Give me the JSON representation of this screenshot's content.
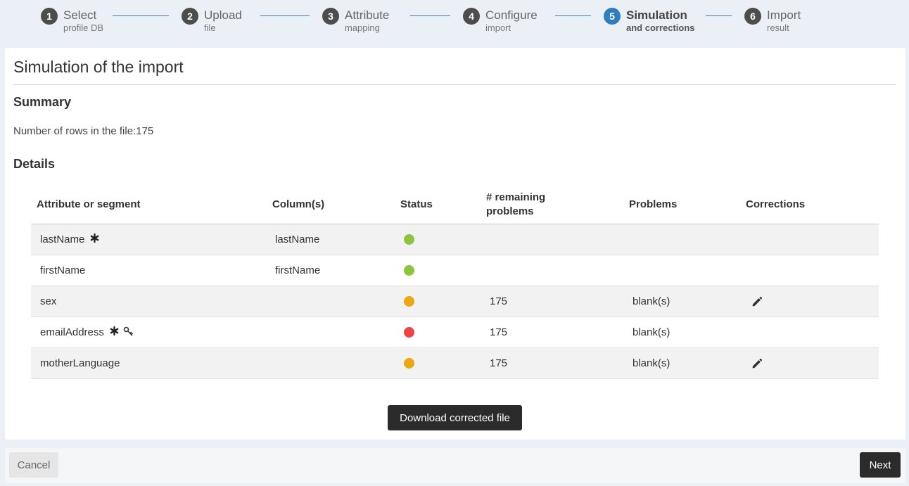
{
  "stepper": {
    "steps": [
      {
        "num": "1",
        "title": "Select",
        "sub": "profile DB"
      },
      {
        "num": "2",
        "title": "Upload",
        "sub": "file"
      },
      {
        "num": "3",
        "title": "Attribute",
        "sub": "mapping"
      },
      {
        "num": "4",
        "title": "Configure",
        "sub": "import"
      },
      {
        "num": "5",
        "title": "Simulation",
        "sub": "and corrections"
      },
      {
        "num": "6",
        "title": "Import",
        "sub": "result"
      }
    ],
    "active_index": 4,
    "accent_color": "#2f7fc0"
  },
  "page": {
    "title": "Simulation of the import",
    "summary_heading": "Summary",
    "rows_label": "Number of rows in the file:175",
    "details_heading": "Details"
  },
  "table": {
    "headers": {
      "attribute": "Attribute or segment",
      "columns": "Column(s)",
      "status": "Status",
      "remaining_1": "# remaining",
      "remaining_2": "problems",
      "problems": "Problems",
      "corrections": "Corrections"
    },
    "rows": [
      {
        "attribute": "lastName",
        "required": true,
        "key": false,
        "column": "lastName",
        "status": "green",
        "remaining": "",
        "problems": "",
        "correctable": false
      },
      {
        "attribute": "firstName",
        "required": false,
        "key": false,
        "column": "firstName",
        "status": "green",
        "remaining": "",
        "problems": "",
        "correctable": false
      },
      {
        "attribute": "sex",
        "required": false,
        "key": false,
        "column": "",
        "status": "orange",
        "remaining": "175",
        "problems": "blank(s)",
        "correctable": true
      },
      {
        "attribute": "emailAddress",
        "required": true,
        "key": true,
        "column": "",
        "status": "red",
        "remaining": "175",
        "problems": "blank(s)",
        "correctable": false
      },
      {
        "attribute": "motherLanguage",
        "required": false,
        "key": false,
        "column": "",
        "status": "orange",
        "remaining": "175",
        "problems": "blank(s)",
        "correctable": true
      }
    ],
    "status_colors": {
      "green": "#8cc43f",
      "orange": "#eba812",
      "red": "#ef4444"
    },
    "icons": {
      "required": "asterisk-icon",
      "key": "key-icon",
      "correction": "pencil-icon"
    }
  },
  "actions": {
    "download_label": "Download corrected file",
    "cancel_label": "Cancel",
    "next_label": "Next"
  }
}
